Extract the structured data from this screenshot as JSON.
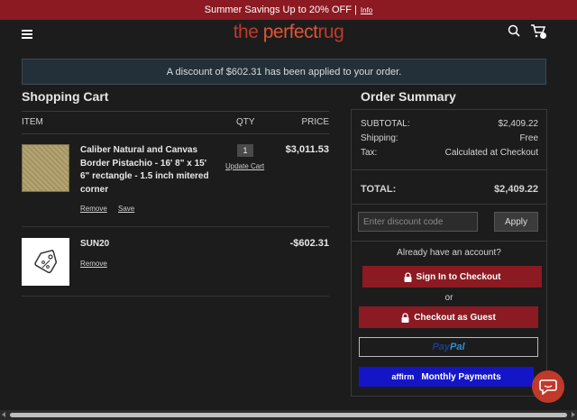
{
  "promo": {
    "text": "Summer Savings Up to 20% OFF |",
    "link": "Info"
  },
  "header": {
    "logo_left": "the ",
    "logo_mid": "perfect",
    "logo_right": "rug",
    "menu_icon": "hamburger-icon",
    "search_icon": "search-icon",
    "cart_icon": "cart-icon"
  },
  "banner": {
    "text": "A discount of $602.31 has been applied to your order."
  },
  "cart": {
    "title": "Shopping Cart",
    "columns": {
      "item": "ITEM",
      "qty": "QTY",
      "price": "PRICE"
    },
    "items": [
      {
        "name": "Caliber Natural and Canvas Border Pistachio - 16' 8\" x 15' 6\" rectangle - 1.5 inch mitered corner",
        "qty": "1",
        "update": "Update Cart",
        "price": "$3,011.53",
        "remove": "Remove",
        "save": "Save"
      },
      {
        "name": "SUN20",
        "price": "-$602.31",
        "remove": "Remove",
        "icon": "tag-icon"
      }
    ]
  },
  "summary": {
    "title": "Order Summary",
    "subtotal_label": "SUBTOTAL:",
    "subtotal": "$2,409.22",
    "shipping_label": "Shipping:",
    "shipping": "Free",
    "tax_label": "Tax:",
    "tax": "Calculated at Checkout",
    "total_label": "TOTAL:",
    "total": "$2,409.22",
    "discount_placeholder": "Enter discount code",
    "apply": "Apply",
    "account_text": "Already have an account?",
    "signin": "Sign In to Checkout",
    "or": "or",
    "guest": "Checkout as Guest",
    "paypal_1": "Pay",
    "paypal_2": "Pal",
    "affirm_logo": "affirm",
    "affirm": "Monthly Payments"
  },
  "colors": {
    "brand_red": "#8b1a22",
    "affirm_blue": "#1515c8",
    "background": "#1c1c1c"
  }
}
